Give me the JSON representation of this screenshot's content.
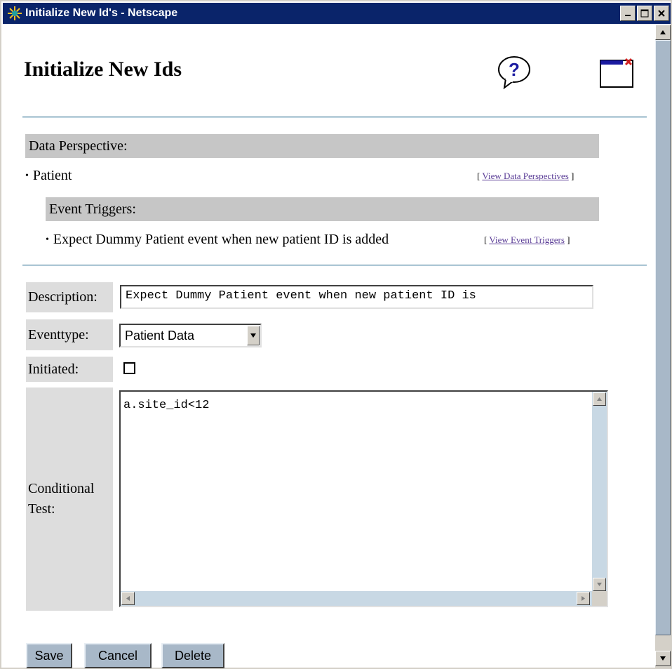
{
  "window": {
    "title": "Initialize New Id's - Netscape"
  },
  "page": {
    "title": "Initialize New Ids"
  },
  "data_perspective": {
    "header": "Data Perspective:",
    "item": "Patient",
    "link_label": "View Data Perspectives",
    "event_triggers": {
      "header": "Event Triggers:",
      "item": "Expect Dummy Patient event when new patient ID is added",
      "link_label": "View Event Triggers"
    }
  },
  "form": {
    "description_label": "Description:",
    "description_value": "Expect Dummy Patient event when new patient ID is",
    "eventtype_label": "Eventtype:",
    "eventtype_value": "Patient Data",
    "initiated_label": "Initiated:",
    "initiated_checked": false,
    "conditional_label_line1": "Conditional",
    "conditional_label_line2": "Test:",
    "conditional_value": "a.site_id<12"
  },
  "buttons": {
    "save": "Save",
    "cancel": "Cancel",
    "delete": "Delete"
  },
  "colors": {
    "titlebar": "#0a246a",
    "section_bar": "#c6c6c6",
    "label_bg": "#dddddd",
    "button_bg": "#a8b8c8",
    "rule": "#5f8fa8",
    "link": "#5a3c96"
  },
  "icons": {
    "title": "netscape-icon",
    "help": "help-icon",
    "close_window": "close-window-icon"
  }
}
